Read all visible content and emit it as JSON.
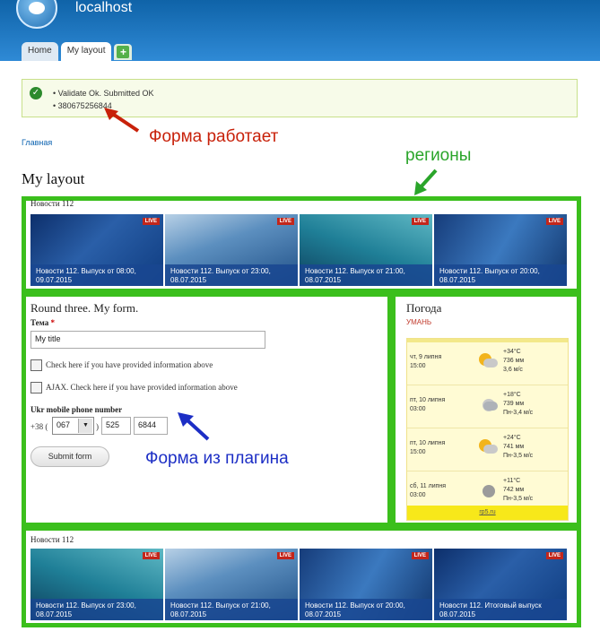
{
  "header": {
    "site_name": "localhost",
    "tabs": [
      "Home",
      "My layout"
    ],
    "add_tab_symbol": "+"
  },
  "messages": {
    "items": [
      "Validate Ok. Submitted OK",
      "380675256844"
    ]
  },
  "breadcrumb": "Главная",
  "page_title": "My layout",
  "annotations": {
    "form_works": "Форма работает",
    "regions": "регионы",
    "plugin_form": "Форма из плагина"
  },
  "news_top": {
    "title": "Новости 112",
    "items": [
      {
        "caption": "Новости 112. Выпуск от 08:00, 09.07.2015"
      },
      {
        "caption": "Новости 112. Выпуск от 23:00, 08.07.2015"
      },
      {
        "caption": "Новости 112. Выпуск от 21:00, 08.07.2015"
      },
      {
        "caption": "Новости 112. Выпуск от 20:00, 08.07.2015"
      }
    ],
    "live_badge": "LIVE"
  },
  "form": {
    "title": "Round three. My form.",
    "tema_label": "Тема",
    "tema_required": "*",
    "tema_value": "My title",
    "checkbox1_label": "Check here if you have provided information above",
    "checkbox2_label": "AJAX. Check here if you have provided information above",
    "phone_label": "Ukr mobile phone number",
    "phone_prefix": "+38 (",
    "phone_code": "067",
    "phone_close": ")",
    "phone_part1": "525",
    "phone_part2": "6844",
    "submit_label": "Submit form"
  },
  "weather": {
    "title": "Погода",
    "city": "УМАНЬ",
    "rows": [
      {
        "date": "чт, 9 липня",
        "time": "15:00",
        "temp": "+34°C",
        "pressure": "736 мм",
        "wind": "3,6 м/с",
        "icon": "partly-cloudy-icon"
      },
      {
        "date": "пт, 10 липня",
        "time": "03:00",
        "temp": "+18°C",
        "pressure": "739 мм",
        "wind": "Пн-3,4 м/с",
        "icon": "cloud-rain-icon"
      },
      {
        "date": "пт, 10 липня",
        "time": "15:00",
        "temp": "+24°C",
        "pressure": "741 мм",
        "wind": "Пн-3,5 м/с",
        "icon": "partly-cloudy-icon"
      },
      {
        "date": "сб, 11 липня",
        "time": "03:00",
        "temp": "+11°C",
        "pressure": "742 мм",
        "wind": "Пн-3,5 м/с",
        "icon": "moon-icon"
      }
    ],
    "footer_link": "rp5.ru"
  },
  "news_bottom": {
    "title": "Новости 112",
    "items": [
      {
        "caption": "Новости 112. Выпуск от 23:00, 08.07.2015"
      },
      {
        "caption": "Новости 112. Выпуск от 21:00, 08.07.2015"
      },
      {
        "caption": "Новости 112. Выпуск от 20:00, 08.07.2015"
      },
      {
        "caption": "Новости 112. Итоговый выпуск 08.07.2015"
      }
    ],
    "live_badge": "LIVE"
  },
  "colors": {
    "region_border": "#3bbf1c",
    "header_blue": "#1f78c8",
    "annotation_red": "#c8210a",
    "annotation_green": "#2aa52a",
    "annotation_blue": "#1c2ec5"
  }
}
